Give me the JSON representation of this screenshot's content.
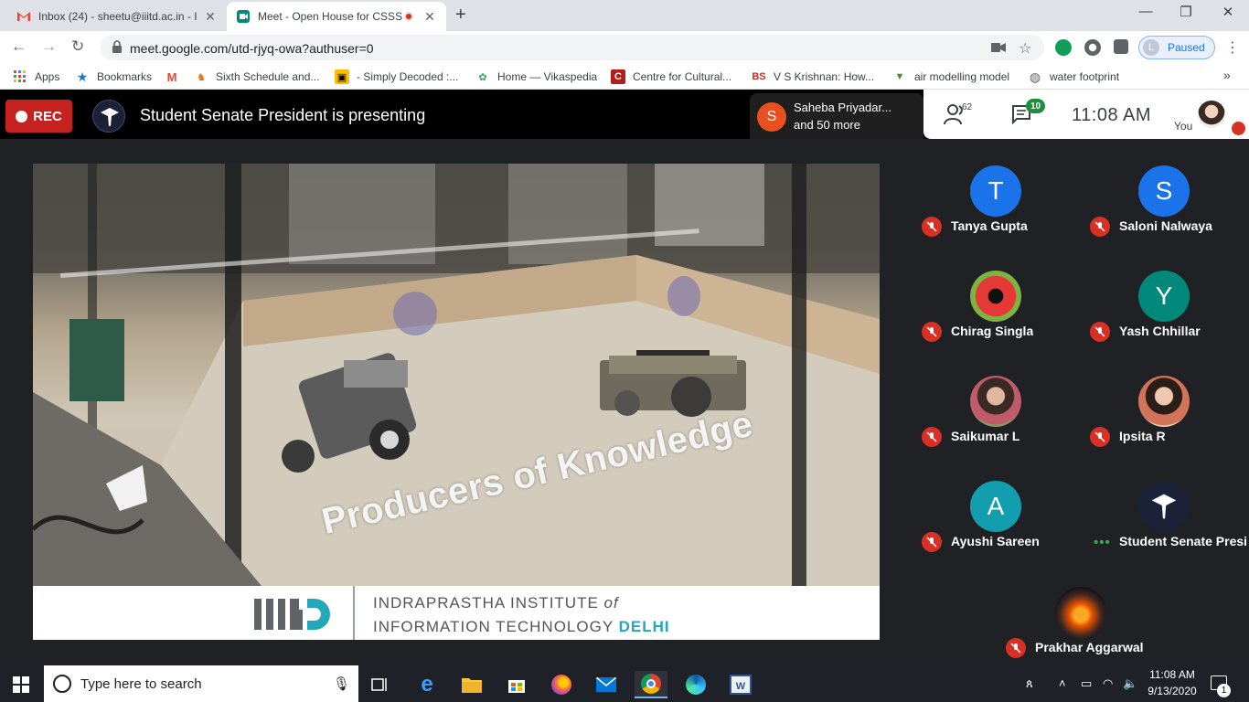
{
  "browser": {
    "tabs": [
      {
        "title": "Inbox (24) - sheetu@iiitd.ac.in - I",
        "active": false
      },
      {
        "title": "Meet - Open House for CSSS",
        "active": true
      }
    ],
    "new_tab": "+",
    "window_controls": {
      "minimize": "—",
      "restore": "❐",
      "close": "✕"
    },
    "url": "meet.google.com/utd-rjyq-owa?authuser=0",
    "profile": {
      "initial": "L",
      "status": "Paused"
    },
    "bookmarks": [
      "Apps",
      "Bookmarks",
      "Sixth Schedule and...",
      "- Simply Decoded :...",
      "Home — Vikaspedia",
      "Centre for Cultural...",
      "V S Krishnan: How...",
      "air modelling model",
      "water footprint"
    ],
    "more_bookmarks": "»"
  },
  "meet": {
    "rec_label": "REC",
    "presenting_text": "Student Senate President is presenting",
    "active_speaker": {
      "initial": "S",
      "line1": "Saheba Priyadar...",
      "line2": "and 50 more",
      "color": "#e8501f"
    },
    "people_count": "62",
    "chat_badge": "10",
    "clock": "11:08  AM",
    "you_label": "You",
    "presentation": {
      "slogan": "Producers of Knowledge",
      "institute_line1_a": "INDRAPRASTHA INSTITUTE ",
      "institute_line1_b": "of",
      "institute_line2_a": "INFORMATION TECHNOLOGY ",
      "institute_line2_b": "DELHI",
      "accent_color": "#22a8b8"
    },
    "participants": [
      {
        "name": "Tanya Gupta",
        "initial": "T",
        "color": "#1a73e8",
        "muted": true
      },
      {
        "name": "Saloni Nalwaya",
        "initial": "S",
        "color": "#1a73e8",
        "muted": true
      },
      {
        "name": "Chirag Singla",
        "initial": "",
        "color": "#7cb342",
        "muted": true
      },
      {
        "name": "Yash Chhillar",
        "initial": "Y",
        "color": "#00897b",
        "muted": true
      },
      {
        "name": "Saikumar L",
        "initial": "",
        "color": "#b85b5b",
        "muted": true
      },
      {
        "name": "Ipsita R",
        "initial": "",
        "color": "#c27a6a",
        "muted": true
      },
      {
        "name": "Ayushi Sareen",
        "initial": "A",
        "color": "#129eaf",
        "muted": true
      },
      {
        "name": "Student Senate Presi...",
        "initial": "",
        "color": "#1b2136",
        "muted": false
      }
    ],
    "last_participant": {
      "name": "Prakhar Aggarwal",
      "muted": true
    }
  },
  "taskbar": {
    "search_placeholder": "Type here to search",
    "time": "11:08 AM",
    "date": "9/13/2020",
    "notification_count": "1"
  }
}
